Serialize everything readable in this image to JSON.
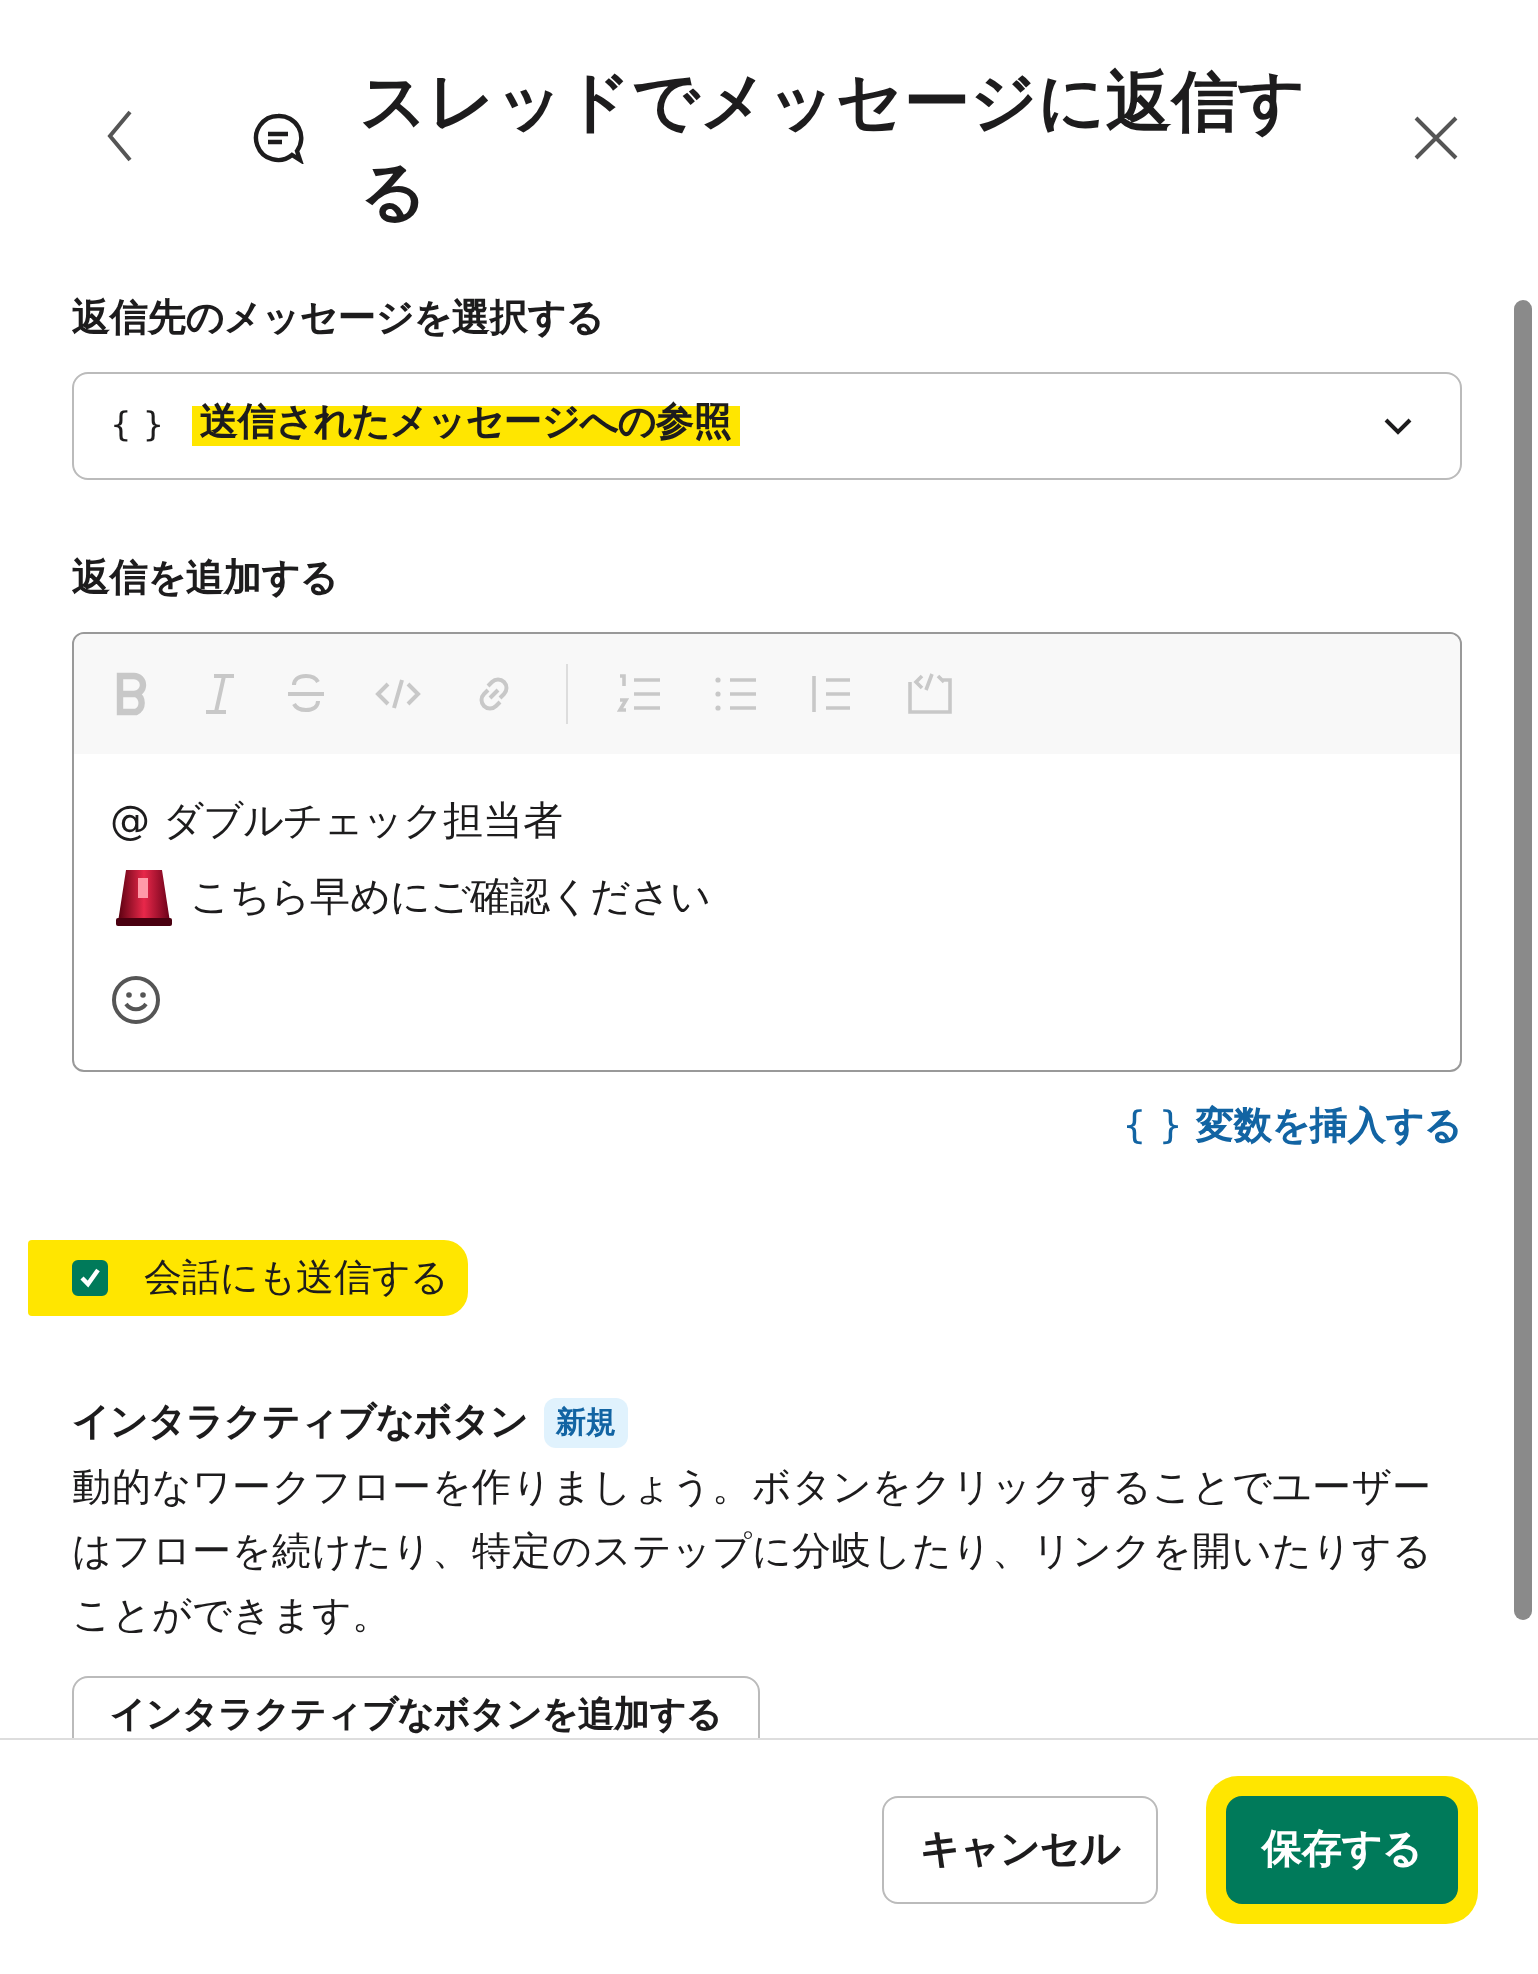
{
  "header": {
    "title": "スレッドでメッセージに返信する"
  },
  "target": {
    "label": "返信先のメッセージを選択する",
    "icon_text": "{ }",
    "value": "送信されたメッセージへの参照",
    "highlighted": true
  },
  "reply": {
    "label": "返信を追加する",
    "lines": [
      {
        "kind": "mention",
        "text": "@ ダブルチェック担当者"
      },
      {
        "kind": "siren",
        "text": "こちら早めにご確認ください"
      }
    ]
  },
  "insert_variable": {
    "icon_text": "{ }",
    "label": "変数を挿入する"
  },
  "send_to_channel": {
    "label": "会話にも送信する",
    "checked": true,
    "highlighted": true
  },
  "interactive": {
    "title": "インタラクティブなボタン",
    "badge": "新規",
    "description": "動的なワークフローを作りましょう。ボタンをクリックすることでユーザーはフローを続けたり、特定のステップに分岐したり、リンクを開いたりすることができます。",
    "button": "インタラクティブなボタンを追加する"
  },
  "footer": {
    "cancel": "キャンセル",
    "save": "保存する",
    "save_highlighted": true
  }
}
